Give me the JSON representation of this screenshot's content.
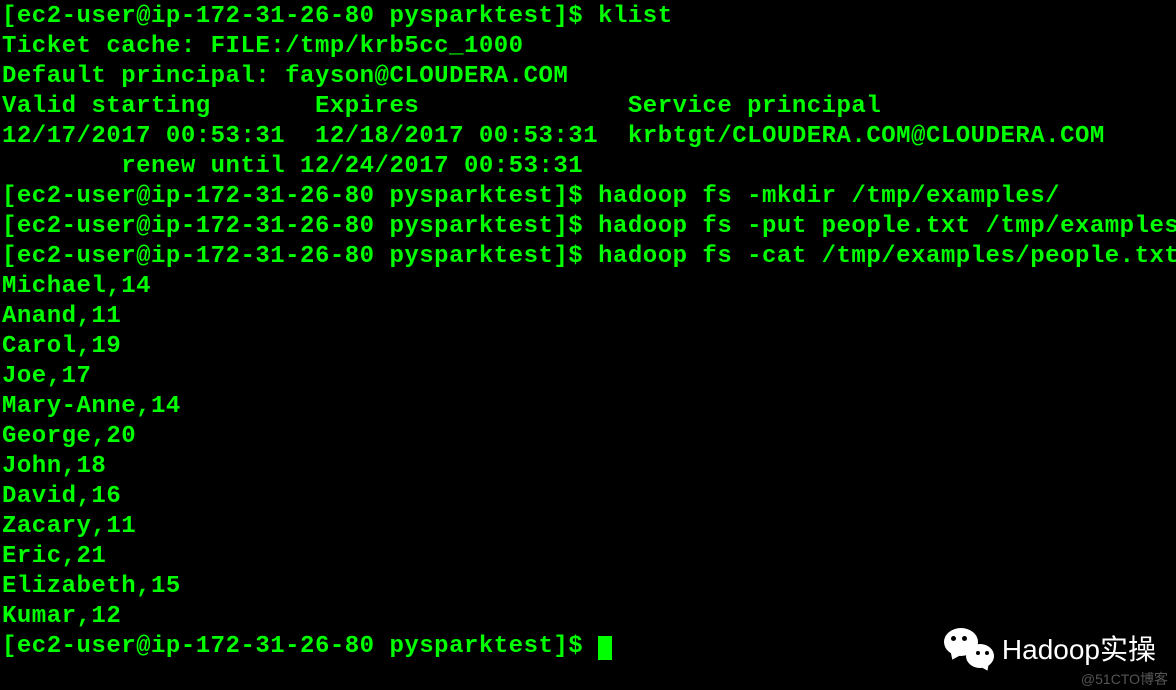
{
  "lines": [
    "[ec2-user@ip-172-31-26-80 pysparktest]$ klist",
    "Ticket cache: FILE:/tmp/krb5cc_1000",
    "Default principal: fayson@CLOUDERA.COM",
    "",
    "Valid starting       Expires              Service principal",
    "12/17/2017 00:53:31  12/18/2017 00:53:31  krbtgt/CLOUDERA.COM@CLOUDERA.COM",
    "        renew until 12/24/2017 00:53:31",
    "[ec2-user@ip-172-31-26-80 pysparktest]$ hadoop fs -mkdir /tmp/examples/",
    "[ec2-user@ip-172-31-26-80 pysparktest]$ hadoop fs -put people.txt /tmp/examples",
    "[ec2-user@ip-172-31-26-80 pysparktest]$ hadoop fs -cat /tmp/examples/people.txt",
    "Michael,14",
    "Anand,11",
    "Carol,19",
    "Joe,17",
    "Mary-Anne,14",
    "George,20",
    "John,18",
    "David,16",
    "Zacary,11",
    "Eric,21",
    "Elizabeth,15",
    "Kumar,12"
  ],
  "prompt_final": "[ec2-user@ip-172-31-26-80 pysparktest]$ ",
  "watermark": {
    "text": "Hadoop实操",
    "sub": "@51CTO博客"
  }
}
